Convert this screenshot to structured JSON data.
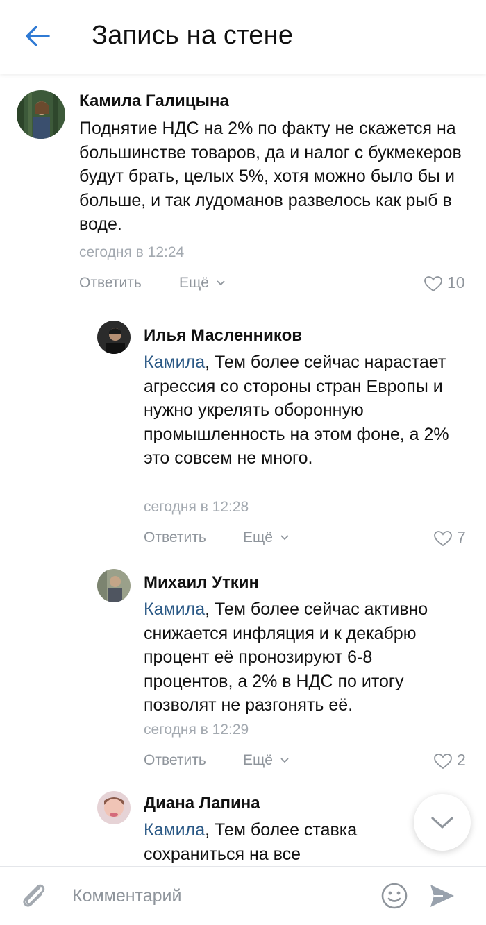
{
  "header": {
    "title": "Запись на стене",
    "back_icon": "arrow-left-icon",
    "accent": "#2f7ad4"
  },
  "comments": [
    {
      "author": "Камила Галицына",
      "mention": "",
      "text": "Поднятие НДС на 2% по факту не скажется на большинстве товаров, да и налог с букмекеров будут брать, целых 5%, хотя можно было бы и больше, и так лудоманов развелось как рыб в воде.",
      "time": "сегодня в 12:24",
      "reply": "Ответить",
      "more": "Ещё",
      "likes": "10"
    },
    {
      "author": "Илья Масленников",
      "mention": "Камила",
      "text": ", Тем более сейчас нарастает агрессия со стороны стран Европы и нужно укрелять оборонную промышленность на этом фоне, а 2% это совсем не много.",
      "time": "сегодня в 12:28",
      "reply": "Ответить",
      "more": "Ещё",
      "likes": "7"
    },
    {
      "author": "Михаил Уткин",
      "mention": "Камила",
      "text": ", Тем более сейчас активно снижается инфляция и к декабрю процент её пронозируют 6-8 процентов, а 2% в НДС по итогу позволят не разгонять её.",
      "time": "сегодня в 12:29",
      "reply": "Ответить",
      "more": "Ещё",
      "likes": "2"
    },
    {
      "author": "Диана Лапина",
      "mention": "Камила",
      "text": ", Тем более ставка сохраниться на все",
      "time": "",
      "reply": "",
      "more": "",
      "likes": ""
    }
  ],
  "composer": {
    "placeholder": "Комментарий",
    "attach_icon": "paperclip-icon",
    "emoji_icon": "smiley-icon",
    "send_icon": "send-icon"
  },
  "scroll_down_icon": "chevron-down-icon",
  "colors": {
    "mention": "#2a5885",
    "meta": "#a3a9b0",
    "action": "#8f959c"
  }
}
